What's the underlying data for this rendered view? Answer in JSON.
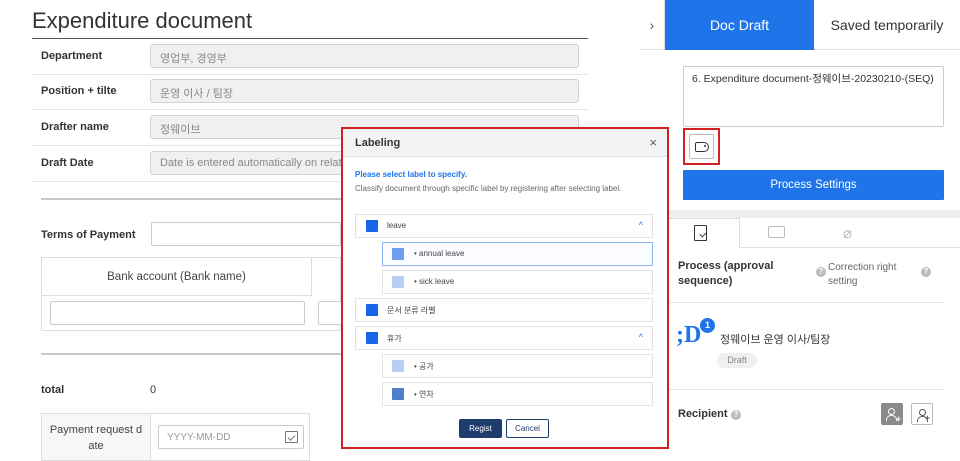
{
  "document": {
    "title": "Expenditure document",
    "fields": [
      {
        "label": "Department",
        "value": "영업부, 경영부"
      },
      {
        "label": "Position + tilte",
        "value": "운영 이사 / 팀장"
      },
      {
        "label": "Drafter name",
        "value": "정웨이브"
      },
      {
        "label": "Draft Date",
        "value": "Date is entered automatically on relat"
      }
    ],
    "terms_label": "Terms of Payment",
    "bank_header": "Bank account (Bank name)",
    "total_label": "total",
    "total_value": "0",
    "payment_request_label_1": "Payment request d",
    "payment_request_label_2": "ate",
    "date_placeholder": "YYYY-MM-DD"
  },
  "right_panel": {
    "collapse_glyph": "›",
    "tabs": {
      "draft": "Doc Draft",
      "saved": "Saved temporarily"
    },
    "doc_title_value": "6. Expenditure document-정웨이브-20230210-(SEQ)",
    "label_button_icon": "tag-icon",
    "process_settings": "Process Settings",
    "icon_tabs": [
      "doc-check-icon",
      "chat-icon",
      "paperclip-icon"
    ],
    "process_title": "Process (approval sequence)",
    "correction_right": "Correction right setting",
    "avatar_letter": ";D",
    "avatar_badge": "1",
    "approver": "정웨이브 운영 이사/팀장",
    "approver_status": "Draft",
    "recipient": "Recipient",
    "help_glyph": "?"
  },
  "modal": {
    "title": "Labeling",
    "close_glyph": "×",
    "hint_primary": "Please select label to specify.",
    "hint_secondary": "Classify document through specific label by registering after selecting label.",
    "labels": [
      {
        "text": "leave",
        "level": "group",
        "color": "#1565e6",
        "expanded": true
      },
      {
        "text": "•  annual leave",
        "level": "child",
        "color": "#6d9ef0",
        "selected": true
      },
      {
        "text": "•  sick leave",
        "level": "child",
        "color": "#b7cdf4"
      },
      {
        "text": "문서 분류 라벨",
        "level": "group",
        "color": "#1565e6"
      },
      {
        "text": "휴가",
        "level": "group",
        "color": "#1565e6",
        "expanded": true
      },
      {
        "text": "•  공가",
        "level": "child",
        "color": "#b7cdf4"
      },
      {
        "text": "•  연차",
        "level": "child",
        "color": "#4f7fcb"
      }
    ],
    "chevron_glyph": "^",
    "regist": "Regist",
    "cancel": "Cancel"
  }
}
